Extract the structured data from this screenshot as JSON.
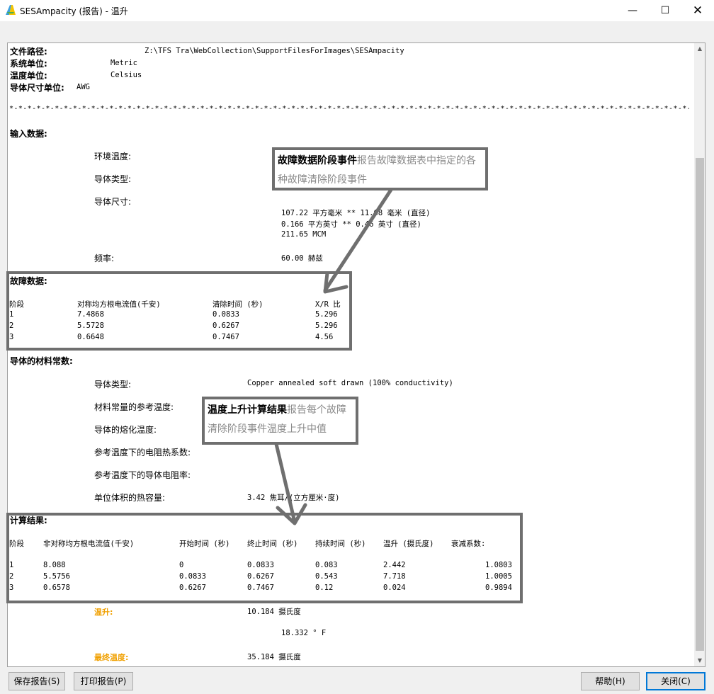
{
  "window": {
    "title": "SESAmpacity (报告) - 温升",
    "min_glyph": "—",
    "max_glyph": "☐",
    "close_glyph": "✕"
  },
  "header": {
    "file_path_label": "文件路径:",
    "file_path_value": "Z:\\TFS Tra\\WebCollection\\SupportFilesForImages\\SESAmpacity",
    "system_units_label": "系统单位:",
    "system_units_value": "Metric",
    "temp_units_label": "温度单位:",
    "temp_units_value": "Celsius",
    "conductor_size_label": "导体尺寸单位:",
    "conductor_size_value": "AWG",
    "separator": "*-*-*-*-*-*-*-*-*-*-*-*-*-*-*-*-*-*-*-*-*-*-*-*-*-*-*-*-*-*-*-*-*-*-*-*-*-*-*-*-*-*-*-*-*-*-*-*-*-*-*-*-*-*-*-*-*-*-*-*-*-*-*-*-*-*-*-*-*-*-*-*-*-*-*-*-*-*-*-*-*-*-*-*-*-*-*-*-*-*-*-*-*-*-*-*-*-*-*-*-*-*-*-*-"
  },
  "input_data": {
    "heading": "输入数据:",
    "ambient_label": "环境温度:",
    "conductor_type_label": "导体类型:",
    "conductor_size_label": "导体尺寸:",
    "size_line1": "107.22  平方毫米  **  11.68  毫米 (直径)",
    "size_line2": "0.166  平方英寸  **  0.46  英寸 (直径)",
    "size_line3": "211.65  MCM",
    "frequency_label": "频率:",
    "frequency_value": "60.00  赫兹"
  },
  "fault_data": {
    "heading": "故障数据:",
    "columns": [
      "阶段",
      "对称均方根电流值(千安)",
      "清除时间 (秒)",
      "X/R 比"
    ],
    "rows": [
      [
        "1",
        "7.4868",
        "0.0833",
        "5.296"
      ],
      [
        "2",
        "5.5728",
        "0.6267",
        "5.296"
      ],
      [
        "3",
        "0.6648",
        "0.7467",
        "4.56"
      ]
    ]
  },
  "material": {
    "heading": "导体的材料常数:",
    "conductor_type_label": "导体类型:",
    "conductor_type_value": "Copper annealed soft drawn (100% conductivity)",
    "ref_temp_label": "材料常量的参考温度:",
    "fusing_label": "导体的熔化温度:",
    "resist_coef_label": "参考温度下的电阻热系数:",
    "resistivity_label": "参考温度下的导体电阻率:",
    "heat_cap_label": "单位体积的热容量:",
    "heat_cap_value": "3.42  焦耳/(立方厘米·度)"
  },
  "results": {
    "heading": "计算结果:",
    "columns": [
      "阶段",
      "非对称均方根电流值(千安)",
      "开始时间 (秒)",
      "终止时间 (秒)",
      "持续时间 (秒)",
      "温升 (摄氏度)",
      "衰减系数:"
    ],
    "rows": [
      [
        "1",
        "8.088",
        "0",
        "0.0833",
        "0.083",
        "2.442",
        "1.0803"
      ],
      [
        "2",
        "5.5756",
        "0.0833",
        "0.6267",
        "0.543",
        "7.718",
        "1.0005"
      ],
      [
        "3",
        "0.6578",
        "0.6267",
        "0.7467",
        "0.12",
        "0.024",
        "0.9894"
      ]
    ],
    "temp_rise_label": "温升:",
    "temp_rise_c": "10.184  摄氏度",
    "temp_rise_f": "18.332  ° F",
    "final_temp_label": "最终温度:",
    "final_temp_value": "35.184  摄氏度"
  },
  "callouts": {
    "fault": {
      "title": "故障数据阶段事件",
      "desc": "报告故障数据表中指定的各种故障清除阶段事件"
    },
    "temp": {
      "title": "温度上升计算结果",
      "desc": "报告每个故障清除阶段事件温度上升中值"
    }
  },
  "scrollbar": {
    "up": "▲",
    "down": "▼"
  },
  "buttons": {
    "save": "保存报告(S)",
    "print": "打印报告(P)",
    "help": "帮助(H)",
    "close": "关闭(C)"
  },
  "colors": {
    "accent_orange": "#f0a000",
    "highlight_gray": "#6f6f6f",
    "focus_blue": "#0078d7"
  }
}
